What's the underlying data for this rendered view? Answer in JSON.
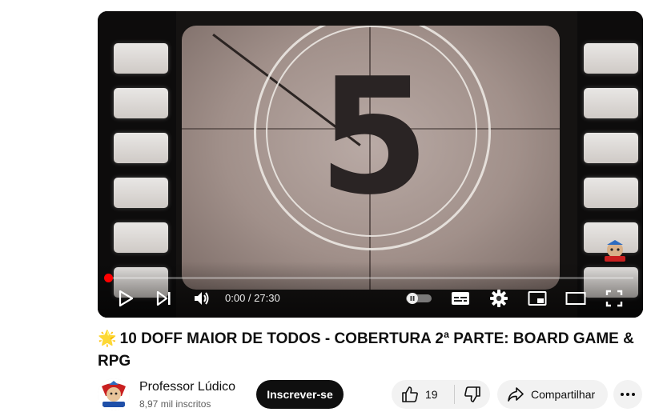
{
  "player": {
    "countdown_number": "5",
    "time_display": "0:00 / 27:30",
    "progress_fraction": 0.0
  },
  "video": {
    "title_emoji": "🌟",
    "title": "10 DOFF MAIOR DE TODOS - COBERTURA 2ª PARTE: BOARD GAME & RPG"
  },
  "channel": {
    "name": "Professor Lúdico",
    "subscribers": "8,97 mil inscritos",
    "subscribe_label": "Inscrever-se"
  },
  "actions": {
    "like_count": "19",
    "share_label": "Compartilhar"
  },
  "icons": {
    "play": "play-icon",
    "next": "next-icon",
    "volume": "volume-icon",
    "autoplay": "autoplay-toggle-icon",
    "subtitles": "subtitles-icon",
    "settings": "gear-icon",
    "miniplayer": "miniplayer-icon",
    "theater": "theater-mode-icon",
    "fullscreen": "fullscreen-icon",
    "like": "thumbs-up-icon",
    "dislike": "thumbs-down-icon",
    "share": "share-icon",
    "more": "more-horizontal-icon"
  },
  "colors": {
    "progress": "#ff0000",
    "subscribe_bg": "#0f0f0f",
    "pill_bg": "#f2f2f2"
  }
}
